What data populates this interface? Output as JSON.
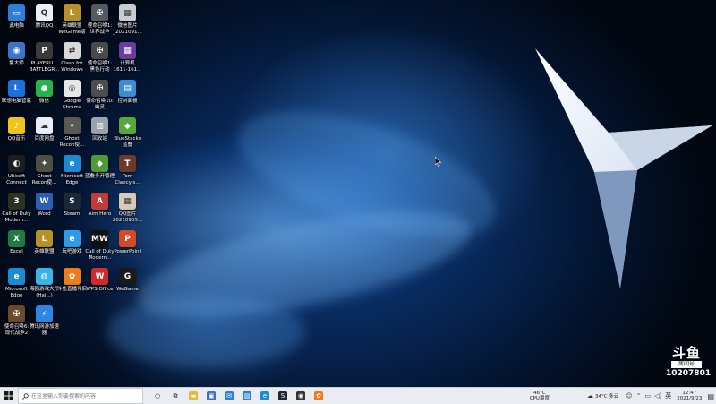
{
  "desktop_icons": [
    {
      "label": "此电脑",
      "color": "#2b7fd6",
      "sym": "▭"
    },
    {
      "label": "腾讯QQ",
      "color": "#e9f0f7",
      "sym": "Q"
    },
    {
      "label": "英雄联盟\nWeGame版",
      "color": "#b8902a",
      "sym": "L"
    },
    {
      "label": "使命召唤1:\n世界战争",
      "color": "#555a60",
      "sym": "✠"
    },
    {
      "label": "微信图片\n_2021091...",
      "color": "#c7ccd2",
      "sym": "▦"
    },
    {
      "label": "鲁大师",
      "color": "#3b74c9",
      "sym": "◉"
    },
    {
      "label": "PLAYERU...\nBATTLEGR...",
      "color": "#3a3a3a",
      "sym": "P"
    },
    {
      "label": "Clash for\nWindows",
      "color": "#d9d9d9",
      "sym": "⇄"
    },
    {
      "label": "使命召唤1:\n黑色行动",
      "color": "#4a4a4a",
      "sym": "✠"
    },
    {
      "label": "计算机\n1611-161...",
      "color": "#6a3c9c",
      "sym": "▦"
    },
    {
      "label": "联想电脑管家",
      "color": "#1b6fe0",
      "sym": "L"
    },
    {
      "label": "微信",
      "color": "#25b34b",
      "sym": "●"
    },
    {
      "label": "Google\nChrome",
      "color": "#e6e6e6",
      "sym": "◎"
    },
    {
      "label": "使命召唤10:\n幽灵",
      "color": "#4d4d4d",
      "sym": "✠"
    },
    {
      "label": "控制面板",
      "color": "#3a8ed8",
      "sym": "▤"
    },
    {
      "label": "QQ音乐",
      "color": "#f1c41a",
      "sym": "♪"
    },
    {
      "label": "百度网盘",
      "color": "#e9eef8",
      "sym": "☁"
    },
    {
      "label": "Ghost\nRecon使...",
      "color": "#5a5a52",
      "sym": "✦"
    },
    {
      "label": "回收站",
      "color": "#9aa3ad",
      "sym": "▥"
    },
    {
      "label": "BlueStacks\n蓝叠",
      "color": "#57a83a",
      "sym": "◆"
    },
    {
      "label": "Ubisoft\nConnect",
      "color": "#1d1d1d",
      "sym": "◐"
    },
    {
      "label": "Ghost\nRecon使...",
      "color": "#4e4e46",
      "sym": "✦"
    },
    {
      "label": "Microsoft\nEdge",
      "color": "#1e8ad6",
      "sym": "e"
    },
    {
      "label": "蓝叠多开管理",
      "color": "#4e9a36",
      "sym": "◆"
    },
    {
      "label": "Tom\nClancy's...",
      "color": "#6b3a2a",
      "sym": "T"
    },
    {
      "label": "Call of Duty\nModern...",
      "color": "#2b3222",
      "sym": "3"
    },
    {
      "label": "Word",
      "color": "#2b5fb4",
      "sym": "W"
    },
    {
      "label": "Steam",
      "color": "#1b2838",
      "sym": "S"
    },
    {
      "label": "Aim Hero",
      "color": "#c43a3a",
      "sym": "A"
    },
    {
      "label": "QQ图片\n20210905...",
      "color": "#d9c9b9",
      "sym": "▦"
    },
    {
      "label": "Excel",
      "color": "#1f7a44",
      "sym": "X"
    },
    {
      "label": "英雄联盟",
      "color": "#b8902a",
      "sym": "L"
    },
    {
      "label": "玩吧游戏",
      "color": "#2f9be8",
      "sym": "e"
    },
    {
      "label": "Call of Duty\nModern...",
      "color": "#111111",
      "sym": "MW"
    },
    {
      "label": "PowerPoint",
      "color": "#d04a2a",
      "sym": "P"
    },
    {
      "label": "Microsoft\nEdge",
      "color": "#1e8ad6",
      "sym": "e"
    },
    {
      "label": "海鸥游戏大厅\n(Hai...)",
      "color": "#37b5e8",
      "sym": "◍"
    },
    {
      "label": "斗鱼直播伴侣",
      "color": "#f07b1c",
      "sym": "✿"
    },
    {
      "label": "WPS Office",
      "color": "#d22a2a",
      "sym": "W"
    },
    {
      "label": "WeGame",
      "color": "#1a1a1a",
      "sym": "G"
    },
    {
      "label": "使命召唤6:\n现代战争2",
      "color": "#6b4a2a",
      "sym": "✠"
    },
    {
      "label": "腾讯网游加速\n器",
      "color": "#2a86e0",
      "sym": "⚡"
    }
  ],
  "watermark": {
    "logo": "斗鱼",
    "sub": "房间号",
    "room_id": "10207801"
  },
  "taskbar": {
    "search_placeholder": "在这里输入你要搜索的内容",
    "apps": [
      {
        "name": "cortana-icon",
        "color": "#ffffff",
        "sym": "○"
      },
      {
        "name": "task-view-icon",
        "color": "#ffffff",
        "sym": "⧉"
      },
      {
        "name": "file-explorer-icon",
        "color": "#e8b93a",
        "sym": "▬"
      },
      {
        "name": "store-icon",
        "color": "#3a6fd0",
        "sym": "▣"
      },
      {
        "name": "mail-icon",
        "color": "#2a7fd6",
        "sym": "✉"
      },
      {
        "name": "photos-icon",
        "color": "#2a7fd6",
        "sym": "▨"
      },
      {
        "name": "edge-icon",
        "color": "#1e8ad6",
        "sym": "e"
      },
      {
        "name": "steam-icon",
        "color": "#1b2838",
        "sym": "S"
      },
      {
        "name": "obs-icon",
        "color": "#333333",
        "sym": "◉"
      },
      {
        "name": "douyu-icon",
        "color": "#f07b1c",
        "sym": "✿"
      }
    ],
    "cpu_temp": "46°C",
    "cpu_label": "CPU温度",
    "weather": "34°C 多云",
    "ime": "英",
    "time": "12:47",
    "date": "2021/9/23"
  }
}
